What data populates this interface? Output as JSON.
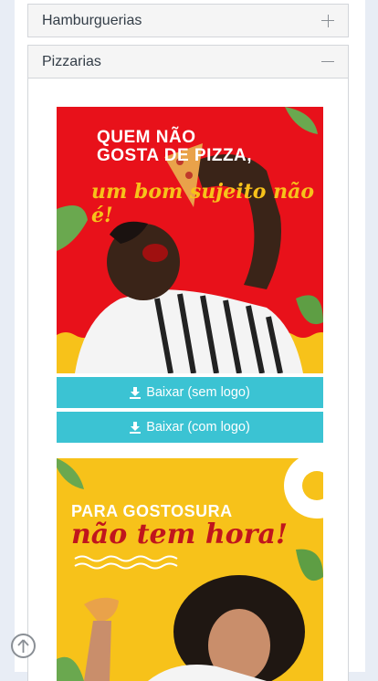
{
  "accordion": {
    "items": [
      {
        "label": "Hamburguerias",
        "state": "collapsed",
        "icon": "plus-icon"
      },
      {
        "label": "Pizzarias",
        "state": "expanded",
        "icon": "minus-icon"
      }
    ]
  },
  "posters": [
    {
      "headline_line1": "QUEM NÃO",
      "headline_line2": "GOSTA DE PIZZA,",
      "script": "um bom sujeito não é!",
      "bg_color": "#e8111a",
      "buttons": [
        "Baixar (sem logo)",
        "Baixar (com logo)"
      ]
    },
    {
      "headline_line1": "PARA GOSTOSURA",
      "script": "não tem hora!",
      "bg_color": "#f7c21a"
    }
  ],
  "colors": {
    "button": "#3bc3d3",
    "panel_border": "#d3d6da",
    "page_bg": "#e8edf5"
  },
  "icons": {
    "download": "download-icon",
    "scroll_top": "arrow-up-circle-icon"
  }
}
